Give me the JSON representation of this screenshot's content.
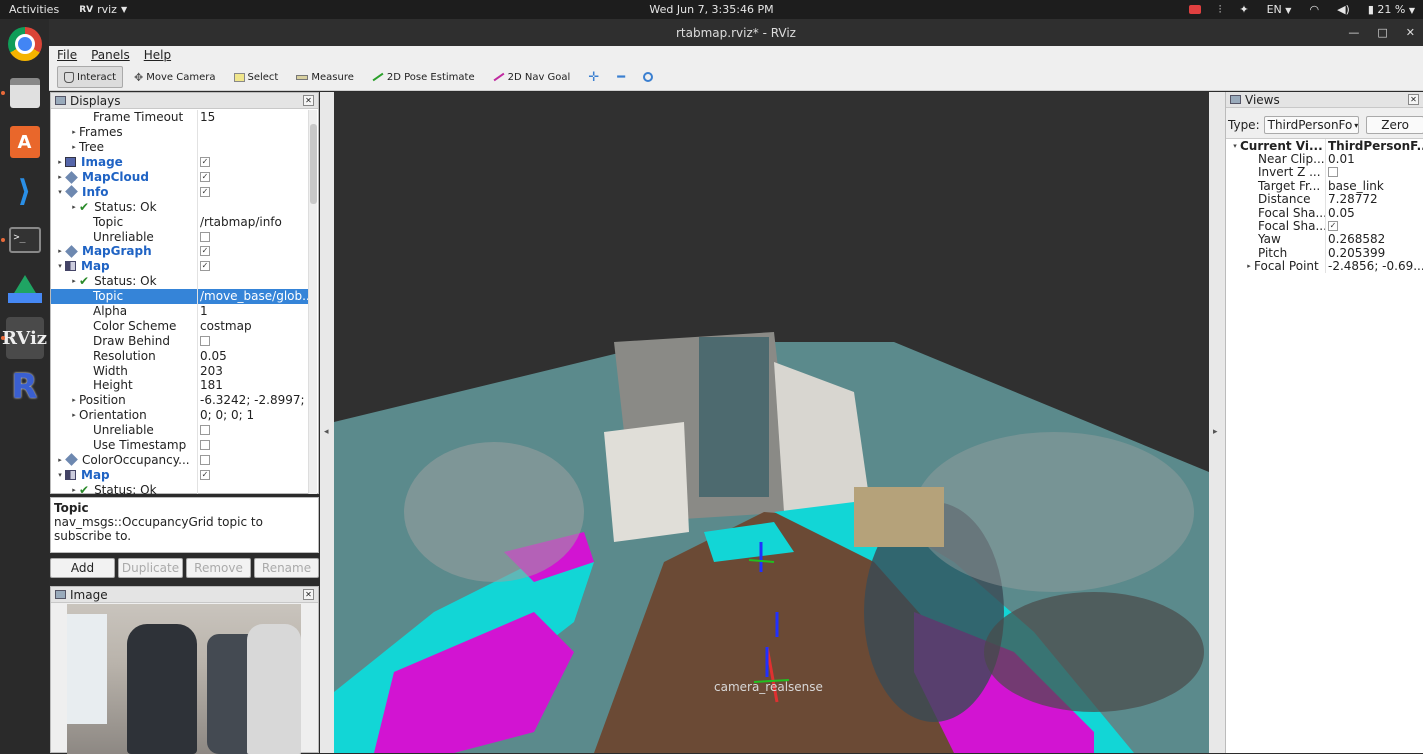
{
  "topbar": {
    "activities": "Activities",
    "app_name": "rviz",
    "clock": "Wed Jun  7,  3:35:46 PM",
    "lang": "EN",
    "battery": "21 %"
  },
  "window": {
    "title": "rtabmap.rviz* - RViz"
  },
  "menu": {
    "file": "File",
    "panels": "Panels",
    "help": "Help"
  },
  "toolbar": {
    "interact": "Interact",
    "move_camera": "Move Camera",
    "select": "Select",
    "measure": "Measure",
    "pose_estimate": "2D Pose Estimate",
    "nav_goal": "2D Nav Goal"
  },
  "displays": {
    "title": "Displays",
    "rows": [
      {
        "indent": 2,
        "arrow": "",
        "icon": "",
        "label": "Frame Timeout",
        "value": "15",
        "style": ""
      },
      {
        "indent": 1,
        "arrow": "▸",
        "icon": "",
        "label": "Frames",
        "value": "",
        "style": ""
      },
      {
        "indent": 1,
        "arrow": "▸",
        "icon": "",
        "label": "Tree",
        "value": "",
        "style": ""
      },
      {
        "indent": 0,
        "arrow": "▸",
        "icon": "img",
        "label": "Image",
        "value": "",
        "check": true,
        "style": "blue"
      },
      {
        "indent": 0,
        "arrow": "▸",
        "icon": "diamond",
        "label": "MapCloud",
        "value": "",
        "check": true,
        "style": "blue"
      },
      {
        "indent": 0,
        "arrow": "▾",
        "icon": "diamond",
        "label": "Info",
        "value": "",
        "check": true,
        "style": "blue"
      },
      {
        "indent": 1,
        "arrow": "▸",
        "icon": "ok",
        "label": "Status: Ok",
        "value": "",
        "style": ""
      },
      {
        "indent": 2,
        "arrow": "",
        "icon": "",
        "label": "Topic",
        "value": "/rtabmap/info",
        "style": ""
      },
      {
        "indent": 2,
        "arrow": "",
        "icon": "",
        "label": "Unreliable",
        "value": "",
        "check": false,
        "style": ""
      },
      {
        "indent": 0,
        "arrow": "▸",
        "icon": "diamond",
        "label": "MapGraph",
        "value": "",
        "check": true,
        "style": "blue"
      },
      {
        "indent": 0,
        "arrow": "▾",
        "icon": "map",
        "label": "Map",
        "value": "",
        "check": true,
        "style": "blue"
      },
      {
        "indent": 1,
        "arrow": "▸",
        "icon": "ok",
        "label": "Status: Ok",
        "value": "",
        "style": ""
      },
      {
        "indent": 2,
        "arrow": "",
        "icon": "",
        "label": "Topic",
        "value": "/move_base/glob...",
        "style": "",
        "selected": true
      },
      {
        "indent": 2,
        "arrow": "",
        "icon": "",
        "label": "Alpha",
        "value": "1",
        "style": ""
      },
      {
        "indent": 2,
        "arrow": "",
        "icon": "",
        "label": "Color Scheme",
        "value": "costmap",
        "style": ""
      },
      {
        "indent": 2,
        "arrow": "",
        "icon": "",
        "label": "Draw Behind",
        "value": "",
        "check": false,
        "style": ""
      },
      {
        "indent": 2,
        "arrow": "",
        "icon": "",
        "label": "Resolution",
        "value": "0.05",
        "style": ""
      },
      {
        "indent": 2,
        "arrow": "",
        "icon": "",
        "label": "Width",
        "value": "203",
        "style": ""
      },
      {
        "indent": 2,
        "arrow": "",
        "icon": "",
        "label": "Height",
        "value": "181",
        "style": ""
      },
      {
        "indent": 1,
        "arrow": "▸",
        "icon": "",
        "label": "Position",
        "value": "-6.3242; -2.8997; 0",
        "style": ""
      },
      {
        "indent": 1,
        "arrow": "▸",
        "icon": "",
        "label": "Orientation",
        "value": "0; 0; 0; 1",
        "style": ""
      },
      {
        "indent": 2,
        "arrow": "",
        "icon": "",
        "label": "Unreliable",
        "value": "",
        "check": false,
        "style": ""
      },
      {
        "indent": 2,
        "arrow": "",
        "icon": "",
        "label": "Use Timestamp",
        "value": "",
        "check": false,
        "style": ""
      },
      {
        "indent": 0,
        "arrow": "▸",
        "icon": "diamond",
        "label": "ColorOccupancy...",
        "value": "",
        "check": false,
        "style": ""
      },
      {
        "indent": 0,
        "arrow": "▾",
        "icon": "map",
        "label": "Map",
        "value": "",
        "check": true,
        "style": "blue"
      },
      {
        "indent": 1,
        "arrow": "▸",
        "icon": "ok",
        "label": "Status: Ok",
        "value": "",
        "style": ""
      }
    ]
  },
  "description": {
    "title": "Topic",
    "text": "nav_msgs::OccupancyGrid topic to subscribe to."
  },
  "buttons": {
    "add": "Add",
    "duplicate": "Duplicate",
    "remove": "Remove",
    "rename": "Rename"
  },
  "image_panel": {
    "title": "Image"
  },
  "viewport": {
    "frame_label": "camera_realsense"
  },
  "views": {
    "title": "Views",
    "type_label": "Type:",
    "type_value": "ThirdPersonFo",
    "zero_label": "Zero",
    "rows": [
      {
        "indent": 0,
        "arrow": "▾",
        "key": "Current Vi...",
        "value": "ThirdPersonF...",
        "bold": true
      },
      {
        "indent": 1,
        "arrow": "",
        "key": "Near Clip...",
        "value": "0.01"
      },
      {
        "indent": 1,
        "arrow": "",
        "key": "Invert Z ...",
        "value": "",
        "check": false
      },
      {
        "indent": 1,
        "arrow": "",
        "key": "Target Fr...",
        "value": "base_link"
      },
      {
        "indent": 1,
        "arrow": "",
        "key": "Distance",
        "value": "7.28772"
      },
      {
        "indent": 1,
        "arrow": "",
        "key": "Focal Sha...",
        "value": "0.05"
      },
      {
        "indent": 1,
        "arrow": "",
        "key": "Focal Sha...",
        "value": "",
        "check": true
      },
      {
        "indent": 1,
        "arrow": "",
        "key": "Yaw",
        "value": "0.268582"
      },
      {
        "indent": 1,
        "arrow": "",
        "key": "Pitch",
        "value": "0.205399"
      },
      {
        "indent": 0,
        "arrow": "▸",
        "key": "Focal Point",
        "value": "-2.4856; -0.69...",
        "sub": true
      }
    ]
  }
}
